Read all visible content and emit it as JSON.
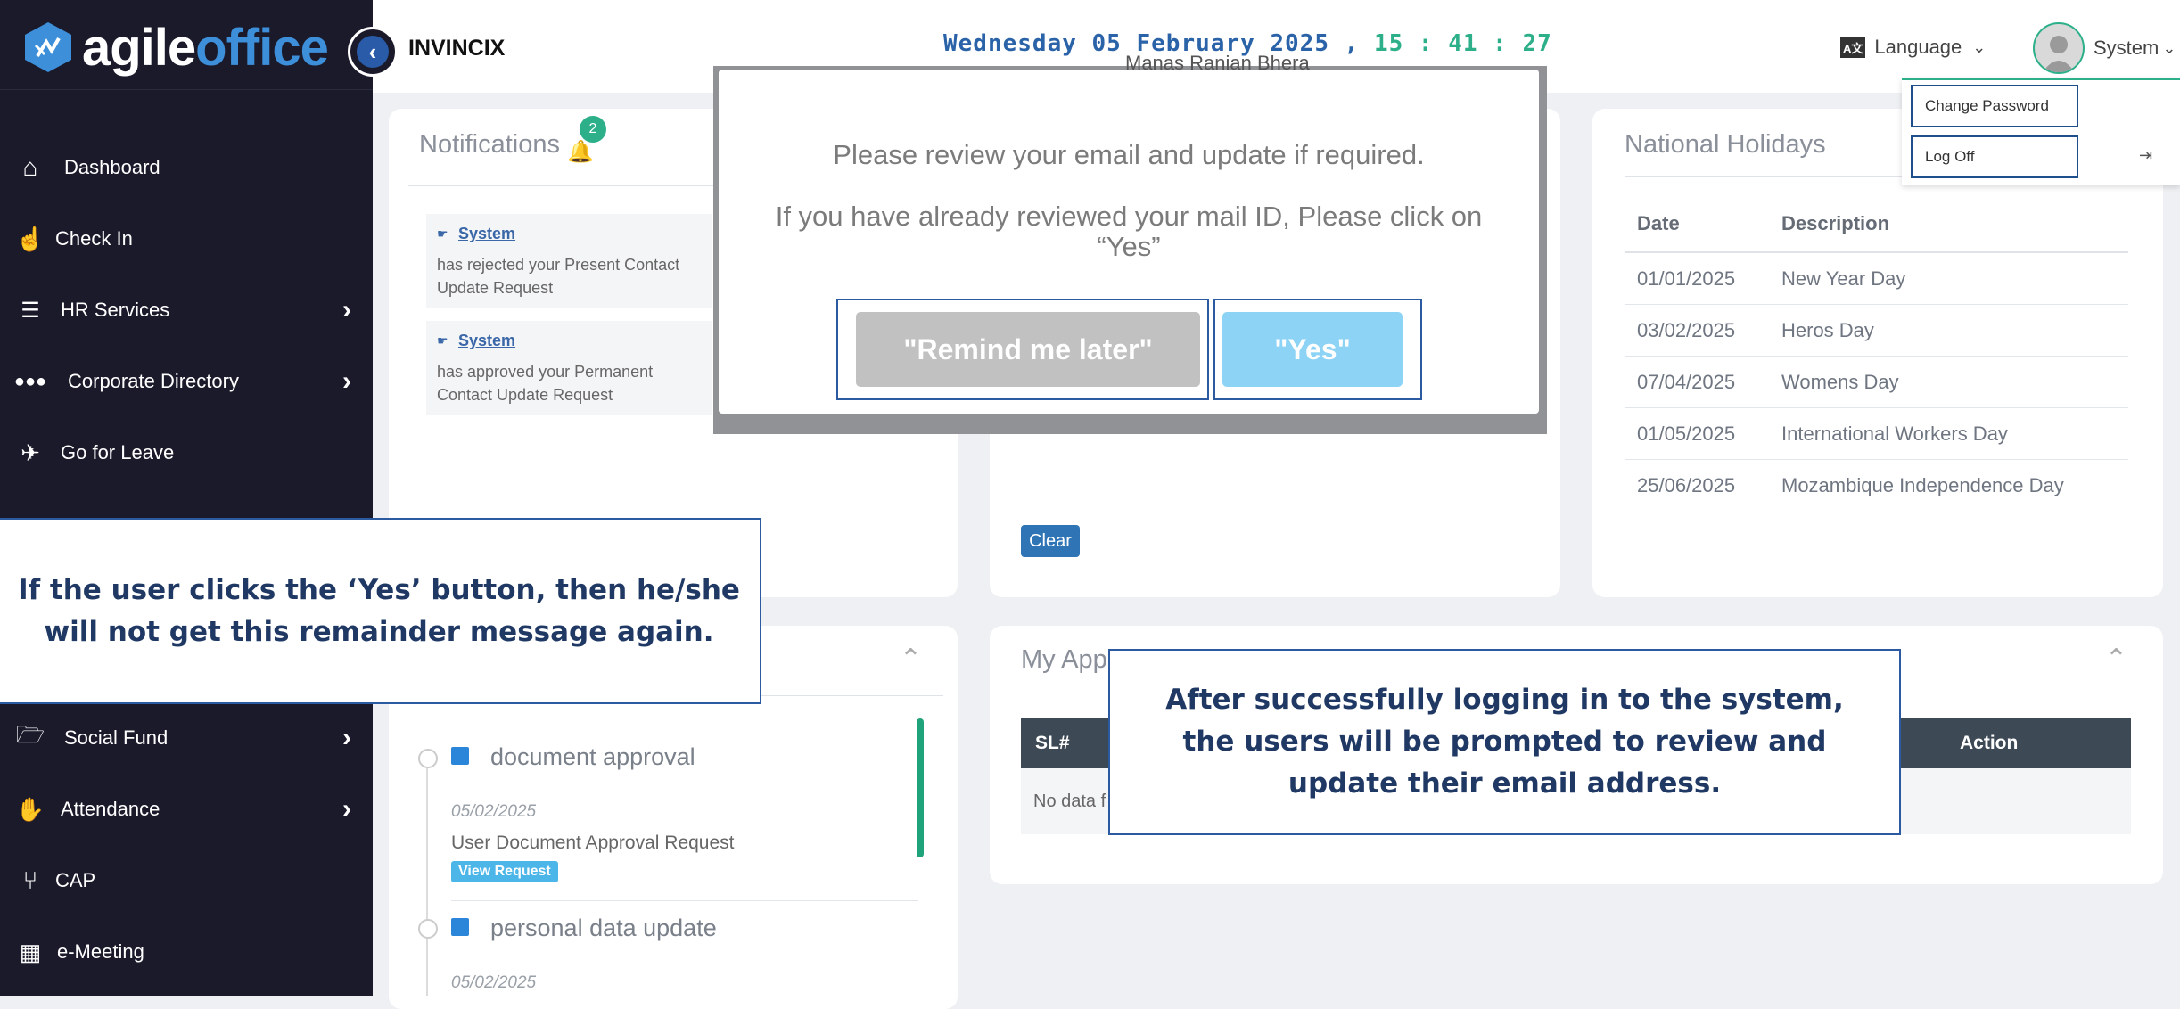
{
  "app": {
    "logo_agile": "agile",
    "logo_office": "office",
    "company": "INVINCIX",
    "date": "Wednesday 05 February 2025 ,",
    "time": "15 : 41 : 27",
    "language_label": "Language",
    "language_icon": "translate-icon",
    "user_name": "System",
    "hidden_user_text": "Manas Ranjan Bhera"
  },
  "sidebar": {
    "items": [
      {
        "label": "Dashboard",
        "icon": "home-icon",
        "glyph": "⌂"
      },
      {
        "label": "Check In",
        "icon": "check-in-icon",
        "glyph": "☝"
      },
      {
        "label": "HR Services",
        "icon": "list-icon",
        "glyph": "☰"
      },
      {
        "label": "Corporate Directory",
        "icon": "users-icon",
        "glyph": "👥"
      },
      {
        "label": "Go for Leave",
        "icon": "leave-icon",
        "glyph": "✈"
      },
      {
        "label": "Social Fund",
        "icon": "folder-open-icon",
        "glyph": "🗁"
      },
      {
        "label": "Attendance",
        "icon": "hand-icon",
        "glyph": "✋"
      },
      {
        "label": "CAP",
        "icon": "branch-icon",
        "glyph": "⑂"
      },
      {
        "label": "e-Meeting",
        "icon": "calendar-icon",
        "glyph": "▦"
      }
    ]
  },
  "dropdown": {
    "change_password": "Change Password",
    "log_off": "Log Off",
    "log_off_icon": "sign-out-icon"
  },
  "notifications": {
    "title": "Notifications",
    "badge": "2",
    "items": [
      {
        "sender": "System",
        "text": "has rejected your Present Contact Update Request"
      },
      {
        "sender": "System",
        "text": "has approved your Permanent Contact Update Request"
      }
    ]
  },
  "holidays": {
    "title": "National Holidays",
    "headers": [
      "Date",
      "Description"
    ],
    "rows": [
      {
        "date": "01/01/2025",
        "desc": "New Year Day"
      },
      {
        "date": "03/02/2025",
        "desc": "Heros Day"
      },
      {
        "date": "07/04/2025",
        "desc": "Womens Day"
      },
      {
        "date": "01/05/2025",
        "desc": "International Workers Day"
      },
      {
        "date": "25/06/2025",
        "desc": "Mozambique Independence Day"
      }
    ]
  },
  "middle_card": {
    "clear_label": "Clear"
  },
  "approvals": {
    "title_visible": "My App",
    "headers": {
      "sl": "SL#",
      "action": "Action"
    },
    "empty_text": "No data f"
  },
  "timeline": {
    "items": [
      {
        "title": "document approval",
        "date": "05/02/2025",
        "desc": "User Document Approval Request",
        "badge": "View Request"
      },
      {
        "title": "personal data update",
        "date": "05/02/2025"
      }
    ]
  },
  "modal": {
    "message1": "Please review your email and update if required.",
    "message2": "If you have already reviewed your mail ID, Please click on “Yes”",
    "remind_label": "\"Remind me later\"",
    "yes_label": "\"Yes\""
  },
  "callouts": {
    "left": "If the user clicks the ‘Yes’ button, then he/she will not get this remainder message again.",
    "center": "After successfully logging in to the system, the users will be prompted to review and update their  email address."
  },
  "colors": {
    "sidebar_bg": "#1b1a2b",
    "accent_blue": "#2b63a8",
    "accent_green": "#2db08a",
    "yes_button": "#8cd3f5",
    "remind_button": "#c1c1c1"
  }
}
